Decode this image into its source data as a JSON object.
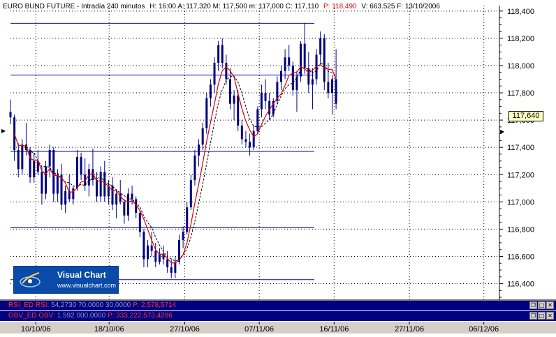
{
  "header": {
    "instrument": "EURO BUND FUTURE - Intradía 240 minutos",
    "ohlc": "H: 16:00  A: 117,320  M: 117,500  m: 117,000  C: 117,110",
    "p_value": "P: 118,490",
    "volume_date": "V: 663.525  F: 13/10/2006"
  },
  "price_label": "117,640",
  "logo": {
    "name": "Visual Chart",
    "url": "www.visualchart.com"
  },
  "rsi_panel": {
    "name": "RSI_ED RSI:",
    "value_hidden_1": "54,2730",
    "value_hidden_2": "70,0000",
    "value_hidden_3": "30,0000",
    "p_value": "P: 2.578,5714"
  },
  "obv_panel": {
    "name": "OBV_ED OBV:",
    "value_hidden": "1.592.000,0000",
    "p_value": "P: 333.222.573,4286"
  },
  "colors": {
    "candle": "#000080",
    "ma_red": "#e00000",
    "ma_dashed": "#000000",
    "hline": "#0000c0",
    "grid": "#000000",
    "panel_bg": "#000080"
  },
  "chart_data": {
    "type": "candlestick",
    "y_ticks": [
      118400,
      118200,
      118000,
      117800,
      117600,
      117400,
      117200,
      117000,
      116800,
      116600,
      116400
    ],
    "y_tick_labels": [
      "118,400",
      "118,200",
      "118,000",
      "117,800",
      "117,600",
      "117,400",
      "117,200",
      "117,000",
      "116,800",
      "116,600",
      "116,400"
    ],
    "ylim": [
      116280,
      118440
    ],
    "x_ticks": [
      "10/10/06",
      "18/10/06",
      "27/10/06",
      "07/11/06",
      "16/11/06",
      "27/11/06",
      "06/12/06"
    ],
    "x_tick_index": [
      6.5,
      25.3,
      44.7,
      63.8,
      83.0,
      102.3,
      121.4
    ],
    "x_range": [
      0,
      124.5
    ],
    "horizontal_lines": [
      118310,
      117930,
      117370,
      116810,
      116430
    ],
    "candles": [
      [
        117660,
        117750,
        117570,
        117620
      ],
      [
        117620,
        117640,
        117300,
        117380
      ],
      [
        117380,
        117430,
        117180,
        117240
      ],
      [
        117240,
        117460,
        117200,
        117420
      ],
      [
        117420,
        117580,
        117340,
        117380
      ],
      [
        117380,
        117400,
        117140,
        117180
      ],
      [
        117180,
        117360,
        117140,
        117300
      ],
      [
        117300,
        117380,
        117200,
        117220
      ],
      [
        117220,
        117260,
        116980,
        117060
      ],
      [
        117060,
        117300,
        117020,
        117260
      ],
      [
        117260,
        117420,
        117180,
        117380
      ],
      [
        117380,
        117400,
        117000,
        117060
      ],
      [
        117060,
        117240,
        117000,
        117200
      ],
      [
        117200,
        117280,
        116940,
        116980
      ],
      [
        116980,
        117120,
        116920,
        117080
      ],
      [
        117080,
        117200,
        117000,
        117020
      ],
      [
        117020,
        117120,
        116980,
        117100
      ],
      [
        117100,
        117380,
        117080,
        117330
      ],
      [
        117330,
        117360,
        117160,
        117200
      ],
      [
        117200,
        117320,
        117080,
        117120
      ],
      [
        117120,
        117280,
        117040,
        117240
      ],
      [
        117240,
        117390,
        117120,
        117160
      ],
      [
        117160,
        117220,
        117000,
        117040
      ],
      [
        117040,
        117260,
        117000,
        117220
      ],
      [
        117220,
        117300,
        117000,
        117040
      ],
      [
        117040,
        117160,
        116980,
        117120
      ],
      [
        117120,
        117180,
        116940,
        116980
      ],
      [
        116980,
        117090,
        116880,
        117060
      ],
      [
        117060,
        117160,
        116980,
        117000
      ],
      [
        117000,
        117020,
        116840,
        116900
      ],
      [
        116900,
        117100,
        116860,
        117060
      ],
      [
        117060,
        117120,
        116980,
        117020
      ],
      [
        117020,
        117040,
        116880,
        116920
      ],
      [
        116920,
        116940,
        116740,
        116780
      ],
      [
        116780,
        116800,
        116520,
        116580
      ],
      [
        116580,
        116720,
        116520,
        116680
      ],
      [
        116680,
        116780,
        116600,
        116640
      ],
      [
        116640,
        116700,
        116520,
        116560
      ],
      [
        116560,
        116660,
        116540,
        116620
      ],
      [
        116620,
        116680,
        116540,
        116580
      ],
      [
        116580,
        116640,
        116480,
        116520
      ],
      [
        116520,
        116580,
        116440,
        116480
      ],
      [
        116480,
        116600,
        116440,
        116560
      ],
      [
        116560,
        116760,
        116540,
        116720
      ],
      [
        116720,
        116820,
        116660,
        116780
      ],
      [
        116780,
        117000,
        116760,
        116960
      ],
      [
        116960,
        117200,
        116940,
        117160
      ],
      [
        117160,
        117380,
        117120,
        117340
      ],
      [
        117340,
        117460,
        117260,
        117420
      ],
      [
        117420,
        117580,
        117380,
        117540
      ],
      [
        117540,
        117800,
        117500,
        117760
      ],
      [
        117760,
        117900,
        117700,
        117860
      ],
      [
        117860,
        118060,
        117800,
        118020
      ],
      [
        118020,
        118180,
        117960,
        118150
      ],
      [
        118150,
        118200,
        117980,
        118020
      ],
      [
        118020,
        118080,
        117860,
        117900
      ],
      [
        117900,
        117980,
        117680,
        117720
      ],
      [
        117720,
        117820,
        117600,
        117780
      ],
      [
        117780,
        117820,
        117520,
        117560
      ],
      [
        117560,
        117600,
        117420,
        117460
      ],
      [
        117460,
        117520,
        117400,
        117440
      ],
      [
        117440,
        117500,
        117340,
        117400
      ],
      [
        117400,
        117560,
        117380,
        117520
      ],
      [
        117520,
        117700,
        117500,
        117680
      ],
      [
        117680,
        117860,
        117620,
        117800
      ],
      [
        117800,
        117900,
        117680,
        117740
      ],
      [
        117740,
        117800,
        117600,
        117640
      ],
      [
        117640,
        117760,
        117620,
        117740
      ],
      [
        117740,
        117920,
        117720,
        117880
      ],
      [
        117880,
        118000,
        117820,
        117960
      ],
      [
        117960,
        118120,
        117900,
        118060
      ],
      [
        118060,
        118150,
        117960,
        118000
      ],
      [
        118000,
        118030,
        117780,
        117820
      ],
      [
        117820,
        117960,
        117660,
        117920
      ],
      [
        117920,
        118180,
        117880,
        118160
      ],
      [
        118160,
        118310,
        117940,
        117980
      ],
      [
        117980,
        118100,
        117800,
        117860
      ],
      [
        117860,
        117980,
        117680,
        117900
      ],
      [
        117900,
        118120,
        117860,
        118080
      ],
      [
        118080,
        118250,
        118000,
        118200
      ],
      [
        118200,
        118230,
        117820,
        117880
      ],
      [
        117880,
        118020,
        117760,
        117800
      ],
      [
        117800,
        117930,
        117640,
        117900
      ],
      [
        117900,
        118120,
        117680,
        117720
      ]
    ]
  }
}
